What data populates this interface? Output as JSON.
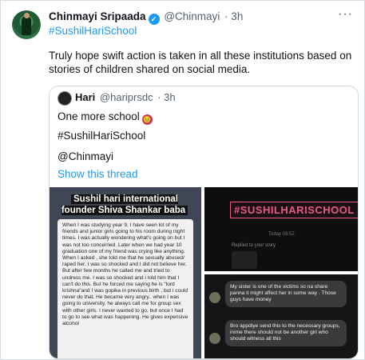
{
  "tweet": {
    "author_name": "Chinmayi Sripaada",
    "verified_mark": "✓",
    "author_handle": "@Chinmayi",
    "time": "· 3h",
    "more": "···",
    "hashtag": "#SushilHariSchool",
    "text": "Truly hope swift action is taken in all these institutions based on stories of children shared on social media."
  },
  "quote": {
    "author_name": "Hari",
    "author_handle": "@hariprsdc",
    "time": "· 3h",
    "line1": "One more school",
    "emoji": "😣",
    "line2": "#SushilHariSchool",
    "line3": "@Chinmayi",
    "show_thread": "Show this thread"
  },
  "media": {
    "image1_title": "Sushil hari international founder Shiva Shankar baba",
    "image1_text": "When I was studying year 9, I have seen lot of my friends and junior girls going to his room during night times. I was actually wondering what's going on but I was not too concerned. Later when we had year 10 graduation one of my friend was crying like anything. When I asked , she told me that he sexually abused/ raped her. I was so shocked and I did not believe her. But after few months he called me and tried to undress me. I was so shocked and i told him that I can't do this. But he forced me saying he is \"lord krishna\"and I was gopika in previous birth , but i could never do that. He became very angry.. when I was going to university, he always call me for group sex with other girls. I never wanted to go, but once I had to go to see what was happening. He gives expensive alcohol",
    "image2_tag": "#SUSHILHARISCHOOL",
    "image2_time": "Today 09:52",
    "image2_reply": "Replied to your story",
    "image3_msg1": "My sister is one of the victims so na share panna it might affect her in some way . Those guys have money",
    "image3_msg2": "Bro appdiye send this to the necessary groups, inime there should not be another girl who should witness all this"
  },
  "colors": {
    "accent": "#1d9bf0",
    "text": "#0f1419",
    "muted": "#536471",
    "border": "#cfd9de"
  }
}
